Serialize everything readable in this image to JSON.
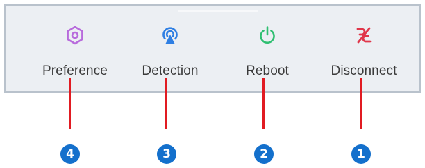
{
  "toolbar": {
    "items": [
      {
        "label": "Preference",
        "icon": "hexagon-settings-icon",
        "color": "#b86bdc"
      },
      {
        "label": "Detection",
        "icon": "wireless-detection-icon",
        "color": "#2f7fe3"
      },
      {
        "label": "Reboot",
        "icon": "power-icon",
        "color": "#2fbf71"
      },
      {
        "label": "Disconnect",
        "icon": "unlink-icon",
        "color": "#e0364a"
      }
    ]
  },
  "callouts": [
    {
      "number": "4",
      "target": "Preference"
    },
    {
      "number": "3",
      "target": "Detection"
    },
    {
      "number": "2",
      "target": "Reboot"
    },
    {
      "number": "1",
      "target": "Disconnect"
    }
  ],
  "colors": {
    "toolbar_bg": "#eceff3",
    "toolbar_border": "#b9c2cc",
    "callout_line": "#e11b22",
    "badge": "#1470cc"
  }
}
